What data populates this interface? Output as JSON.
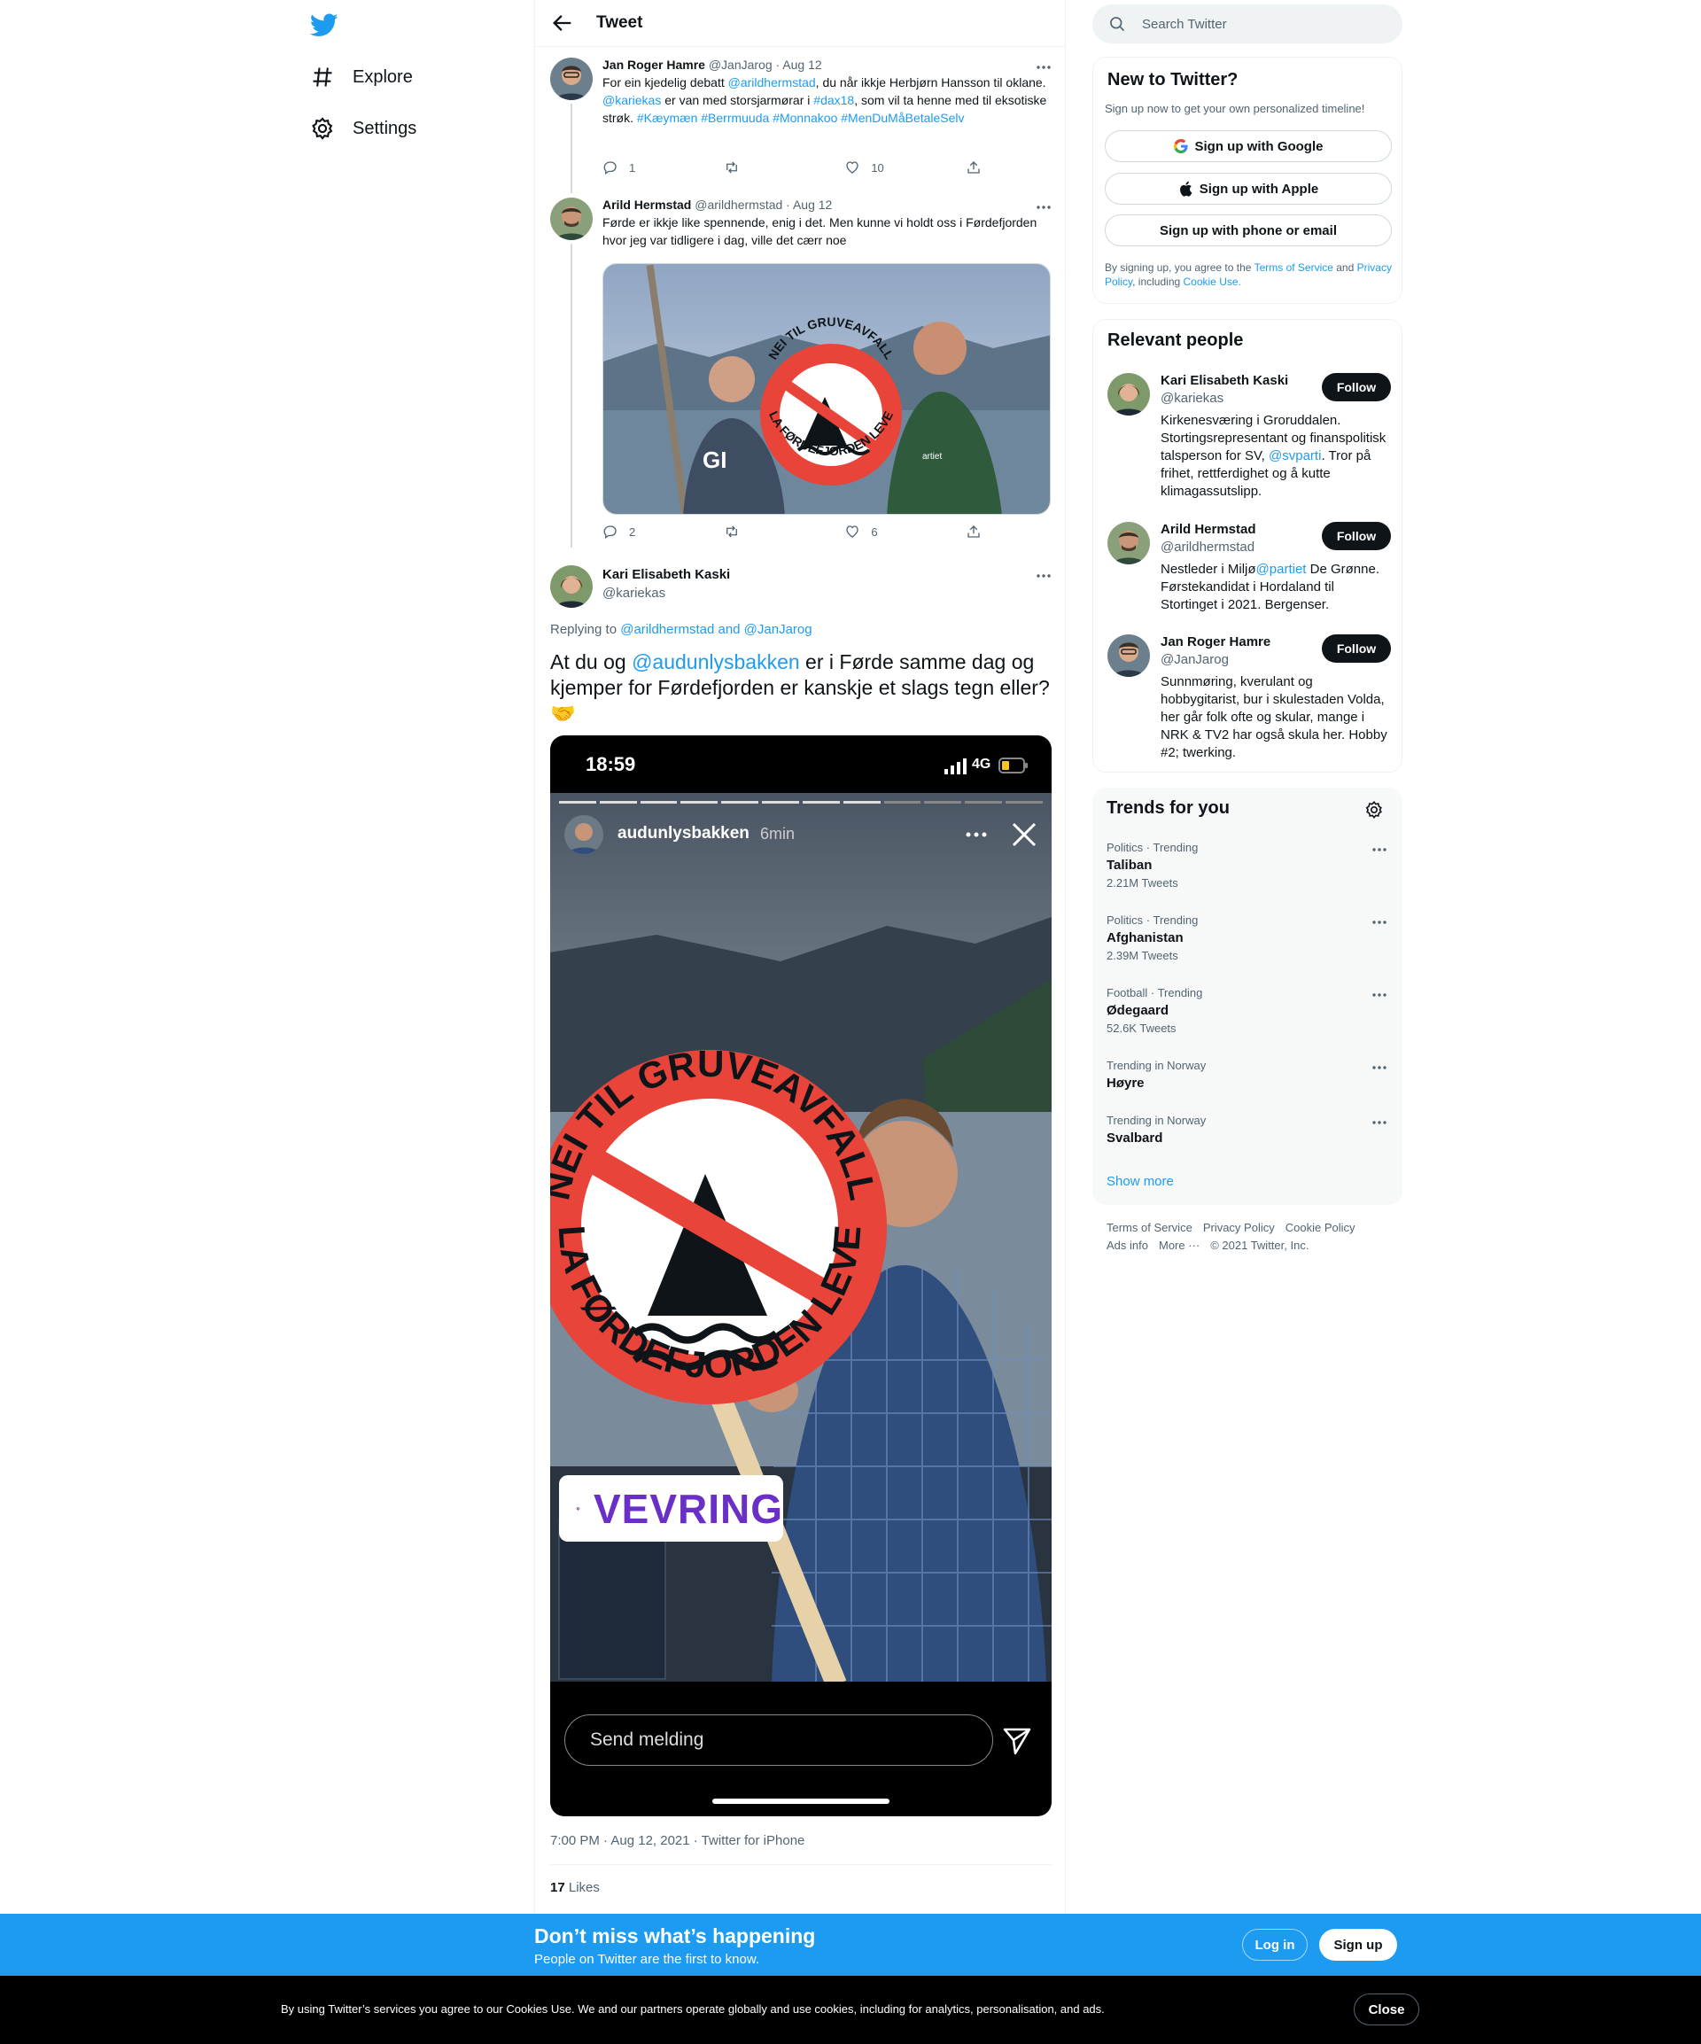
{
  "nav": {
    "explore": "Explore",
    "settings": "Settings"
  },
  "header": {
    "title": "Tweet"
  },
  "tweets": [
    {
      "name": "Jan Roger Hamre",
      "handle": "@JanJarog",
      "date": "· Aug 12",
      "text_parts": {
        "p1": "For ein kjedelig debatt ",
        "m1": "@arildhermstad",
        "p2": ", du når ikkje Herbjørn Hansson til oklane. ",
        "m2": "@kariekas",
        "p3": " er van med storsjarmørar i ",
        "h1": "#dax18",
        "p4": ", som vil ta henne med til eksotiske strøk. ",
        "h2": "#Kæymæn",
        "h3": "#Berrmuuda",
        "h4": "#Monnakoo",
        "h5": "#MenDuMåBetaleSelv"
      },
      "replies": "1",
      "likes": "10"
    },
    {
      "name": "Arild Hermstad",
      "handle": "@arildhermstad",
      "date": "· Aug 12",
      "text": "Førde er ikkje like spennende, enig i det. Men kunne vi holdt oss i Førdefjorden hvor jeg var tidligere i dag, ville det cærr noe",
      "replies": "2",
      "likes": "6",
      "image_sign_top": "NEI TIL GRUVEAVFALL",
      "image_sign_bottom": "LA FØRDEFJORDEN LEVE"
    }
  ],
  "main_tweet": {
    "name": "Kari Elisabeth Kaski",
    "handle": "@kariekas",
    "replying_prefix": "Replying to ",
    "replying_to": "@arildhermstad and @JanJarog",
    "text_a": "At du og ",
    "mention": "@audunlysbakken",
    "text_b": " er i Førde samme dag og kjemper for Førdefjorden er kanskje et slags tegn eller?",
    "emoji": "🤝",
    "timestamp": "7:00 PM · Aug 12, 2021 · Twitter for iPhone",
    "likes_count": "17",
    "likes_label": "Likes"
  },
  "story": {
    "time": "18:59",
    "network": "4G",
    "user": "audunlysbakken",
    "ago": "6min",
    "sign_top": "NEI TIL GRUVEAVFALL",
    "sign_bottom": "LA FØRDEFJORDEN LEVE",
    "location": "VEVRING",
    "message_placeholder": "Send melding"
  },
  "search": {
    "placeholder": "Search Twitter"
  },
  "new_to_twitter": {
    "title": "New to Twitter?",
    "subtitle": "Sign up now to get your own personalized timeline!",
    "google": "Sign up with Google",
    "apple": "Sign up with Apple",
    "phone": "Sign up with phone or email",
    "legal_a": "By signing up, you agree to the ",
    "terms": "Terms of Service",
    "legal_b": " and ",
    "privacy": "Privacy Policy",
    "legal_c": ", including ",
    "cookie": "Cookie Use."
  },
  "relevant": {
    "title": "Relevant people",
    "follow": "Follow",
    "people": [
      {
        "name": "Kari Elisabeth Kaski",
        "handle": "@kariekas",
        "bio_a": "Kirkenesværing i Groruddalen. Stortingsrepresentant og finanspolitisk talsperson for SV, ",
        "bio_link": "@svparti",
        "bio_b": ". Tror på frihet, rettferdighet og å kutte klimagassutslipp."
      },
      {
        "name": "Arild Hermstad",
        "handle": "@arildhermstad",
        "bio_a": "Nestleder i Miljø",
        "bio_link": "@partiet",
        "bio_b": " De Grønne. Førstekandidat i Hordaland til Stortinget i 2021. Bergenser."
      },
      {
        "name": "Jan Roger Hamre",
        "handle": "@JanJarog",
        "bio": "Sunnmøring, kverulant og hobbygitarist, bur i skulestaden Volda, her går folk ofte og skular, mange i NRK & TV2 har også skula her. Hobby #2; twerking."
      }
    ]
  },
  "trends": {
    "title": "Trends for you",
    "items": [
      {
        "category": "Politics · Trending",
        "name": "Taliban",
        "count": "2.21M Tweets"
      },
      {
        "category": "Politics · Trending",
        "name": "Afghanistan",
        "count": "2.39M Tweets"
      },
      {
        "category": "Football · Trending",
        "name": "Ødegaard",
        "count": "52.6K Tweets"
      },
      {
        "category": "Trending in Norway",
        "name": "Høyre",
        "count": ""
      },
      {
        "category": "Trending in Norway",
        "name": "Svalbard",
        "count": ""
      }
    ],
    "show_more": "Show more"
  },
  "footer": {
    "terms": "Terms of Service",
    "privacy": "Privacy Policy",
    "cookie": "Cookie Policy",
    "ads": "Ads info",
    "more": "More ···",
    "copyright": "© 2021 Twitter, Inc."
  },
  "bottom_bar": {
    "title": "Don’t miss what’s happening",
    "subtitle": "People on Twitter are the first to know.",
    "login": "Log in",
    "signup": "Sign up"
  },
  "cookie_bar": {
    "text": "By using Twitter’s services you agree to our Cookies Use. We and our partners operate globally and use cookies, including for analytics, personalisation, and ads.",
    "close": "Close"
  },
  "colors": {
    "accent": "#1d9bf0",
    "text": "#0f1419",
    "secondary": "#536471",
    "sign_red": "#e8443a"
  }
}
